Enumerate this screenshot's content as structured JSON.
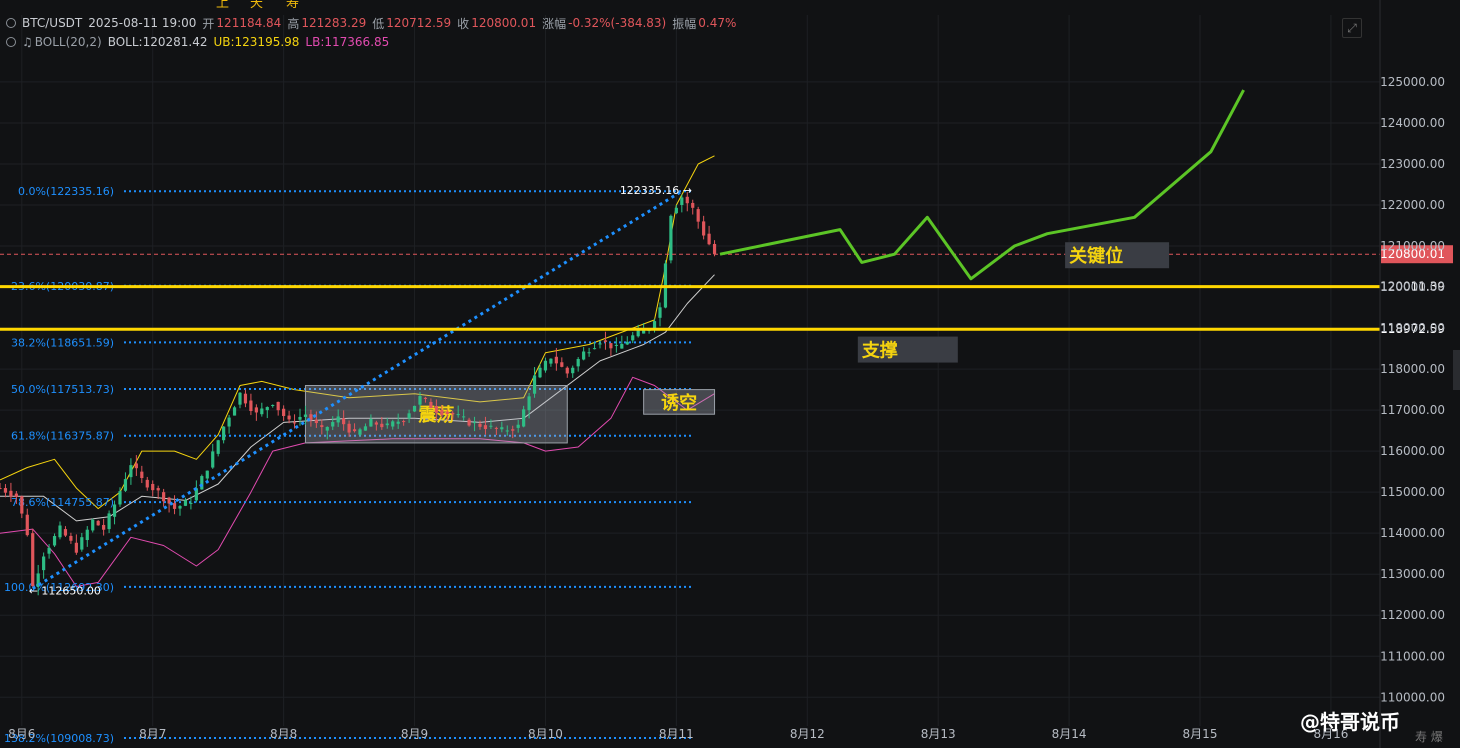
{
  "header": {
    "pair": "BTC/USDT",
    "datetime": "2025-08-11 19:00",
    "open_label": "开",
    "open": "121184.84",
    "high_label": "高",
    "high": "121283.29",
    "low_label": "低",
    "low": "120712.59",
    "close_label": "收",
    "close": "120800.01",
    "change_label": "涨幅",
    "change": "-0.32%(-384.83)",
    "amp_label": "振幅",
    "amp": "0.47%"
  },
  "indicator": {
    "name": "BOLL(20,2)",
    "boll": "BOLL:120281.42",
    "ub": "UB:123195.98",
    "lb": "LB:117366.85"
  },
  "toolbar": {
    "items": [
      "上",
      "天",
      "寿",
      "⟲",
      "≈",
      "⊡",
      "⊘",
      "⊟",
      "⊖",
      "⊕",
      "⊚",
      "⊏",
      "⊐"
    ]
  },
  "expand_icon": "expand-icon",
  "brand": "@特哥说币",
  "footer_note": "寿 爆",
  "colors": {
    "background": "#111214",
    "up": "#2ebd85",
    "down": "#e0565b",
    "fib": "#1e90ff",
    "boll_mid": "#cfcfcf",
    "boll_ub": "#f5d40f",
    "boll_lb": "#e24bb0",
    "key_line": "#ffd700",
    "forecast": "#5cc526"
  },
  "chart_data": {
    "type": "candlestick",
    "title": "",
    "ylim": [
      109300,
      125900
    ],
    "xlim": [
      "2025-08-05 20:00",
      "2025-08-16 09:00"
    ],
    "grid": true,
    "x_ticks": [
      "8月6",
      "8月7",
      "8月8",
      "8月9",
      "8月10",
      "8月11",
      "8月12",
      "8月13",
      "8月14",
      "8月15",
      "8月16"
    ],
    "y_ticks": [
      "110000.00",
      "111000.00",
      "112000.00",
      "113000.00",
      "114000.00",
      "115000.00",
      "116000.00",
      "117000.00",
      "118000.00",
      "119000.00",
      "120000.00",
      "121000.00",
      "122000.00",
      "123000.00",
      "124000.00",
      "125000.00"
    ],
    "ohlc_path": [
      [
        "2025-08-05 20:00",
        115100
      ],
      [
        "2025-08-05 23:00",
        114900
      ],
      [
        "2025-08-06 01:00",
        114000
      ],
      [
        "2025-08-06 02:00",
        112700
      ],
      [
        "2025-08-06 04:00",
        113500
      ],
      [
        "2025-08-06 07:00",
        114100
      ],
      [
        "2025-08-06 10:00",
        113600
      ],
      [
        "2025-08-06 13:00",
        114300
      ],
      [
        "2025-08-06 15:00",
        114100
      ],
      [
        "2025-08-06 17:00",
        114700
      ],
      [
        "2025-08-06 20:00",
        115700
      ],
      [
        "2025-08-06 22:00",
        115300
      ],
      [
        "2025-08-07 01:00",
        115000
      ],
      [
        "2025-08-07 04:00",
        114600
      ],
      [
        "2025-08-07 07:00",
        114800
      ],
      [
        "2025-08-07 10:00",
        115600
      ],
      [
        "2025-08-07 13:00",
        116600
      ],
      [
        "2025-08-07 16:00",
        117400
      ],
      [
        "2025-08-07 19:00",
        116900
      ],
      [
        "2025-08-07 22:00",
        117200
      ],
      [
        "2025-08-08 01:00",
        116700
      ],
      [
        "2025-08-08 04:00",
        116900
      ],
      [
        "2025-08-08 07:00",
        116500
      ],
      [
        "2025-08-08 10:00",
        116800
      ],
      [
        "2025-08-08 13:00",
        116400
      ],
      [
        "2025-08-08 16:00",
        116700
      ],
      [
        "2025-08-08 19:00",
        116600
      ],
      [
        "2025-08-08 22:00",
        116800
      ],
      [
        "2025-08-09 01:00",
        117300
      ],
      [
        "2025-08-09 04:00",
        117000
      ],
      [
        "2025-08-09 07:00",
        116900
      ],
      [
        "2025-08-09 10:00",
        116700
      ],
      [
        "2025-08-09 13:00",
        116600
      ],
      [
        "2025-08-09 16:00",
        116500
      ],
      [
        "2025-08-09 19:00",
        116600
      ],
      [
        "2025-08-09 22:00",
        117800
      ],
      [
        "2025-08-10 01:00",
        118300
      ],
      [
        "2025-08-10 04:00",
        117900
      ],
      [
        "2025-08-10 07:00",
        118400
      ],
      [
        "2025-08-10 10:00",
        118700
      ],
      [
        "2025-08-10 13:00",
        118500
      ],
      [
        "2025-08-10 16:00",
        118800
      ],
      [
        "2025-08-10 19:00",
        119000
      ],
      [
        "2025-08-10 21:00",
        119500
      ],
      [
        "2025-08-10 23:00",
        121800
      ],
      [
        "2025-08-11 01:00",
        122200
      ],
      [
        "2025-08-11 03:00",
        121900
      ],
      [
        "2025-08-11 05:00",
        121300
      ],
      [
        "2025-08-11 07:00",
        120800
      ]
    ],
    "boll_ub": [
      [
        "2025-08-05 20:00",
        115300
      ],
      [
        "2025-08-06 01:00",
        115600
      ],
      [
        "2025-08-06 06:00",
        115800
      ],
      [
        "2025-08-06 10:00",
        115100
      ],
      [
        "2025-08-06 14:00",
        114600
      ],
      [
        "2025-08-06 18:00",
        115000
      ],
      [
        "2025-08-06 22:00",
        116000
      ],
      [
        "2025-08-07 04:00",
        116000
      ],
      [
        "2025-08-07 08:00",
        115800
      ],
      [
        "2025-08-07 12:00",
        116400
      ],
      [
        "2025-08-07 16:00",
        117600
      ],
      [
        "2025-08-07 20:00",
        117700
      ],
      [
        "2025-08-08 02:00",
        117500
      ],
      [
        "2025-08-08 12:00",
        117300
      ],
      [
        "2025-08-09 00:00",
        117400
      ],
      [
        "2025-08-09 12:00",
        117200
      ],
      [
        "2025-08-09 20:00",
        117300
      ],
      [
        "2025-08-10 00:00",
        118400
      ],
      [
        "2025-08-10 08:00",
        118600
      ],
      [
        "2025-08-10 16:00",
        119000
      ],
      [
        "2025-08-10 20:00",
        119200
      ],
      [
        "2025-08-10 22:00",
        120500
      ],
      [
        "2025-08-11 00:00",
        122000
      ],
      [
        "2025-08-11 04:00",
        123000
      ],
      [
        "2025-08-11 07:00",
        123200
      ]
    ],
    "boll_mid": [
      [
        "2025-08-05 20:00",
        114900
      ],
      [
        "2025-08-06 04:00",
        114900
      ],
      [
        "2025-08-06 10:00",
        114300
      ],
      [
        "2025-08-06 16:00",
        114400
      ],
      [
        "2025-08-06 22:00",
        114900
      ],
      [
        "2025-08-07 06:00",
        114800
      ],
      [
        "2025-08-07 12:00",
        115200
      ],
      [
        "2025-08-07 18:00",
        116100
      ],
      [
        "2025-08-08 00:00",
        116700
      ],
      [
        "2025-08-08 12:00",
        116800
      ],
      [
        "2025-08-09 00:00",
        116800
      ],
      [
        "2025-08-09 12:00",
        116700
      ],
      [
        "2025-08-09 20:00",
        116800
      ],
      [
        "2025-08-10 02:00",
        117400
      ],
      [
        "2025-08-10 10:00",
        118200
      ],
      [
        "2025-08-10 18:00",
        118600
      ],
      [
        "2025-08-10 22:00",
        118900
      ],
      [
        "2025-08-11 02:00",
        119600
      ],
      [
        "2025-08-11 07:00",
        120300
      ]
    ],
    "boll_lb": [
      [
        "2025-08-05 20:00",
        114000
      ],
      [
        "2025-08-06 02:00",
        114100
      ],
      [
        "2025-08-06 06:00",
        113500
      ],
      [
        "2025-08-06 10:00",
        112700
      ],
      [
        "2025-08-06 14:00",
        112800
      ],
      [
        "2025-08-06 20:00",
        113900
      ],
      [
        "2025-08-07 02:00",
        113700
      ],
      [
        "2025-08-07 08:00",
        113200
      ],
      [
        "2025-08-07 12:00",
        113600
      ],
      [
        "2025-08-07 18:00",
        115000
      ],
      [
        "2025-08-07 22:00",
        116000
      ],
      [
        "2025-08-08 04:00",
        116200
      ],
      [
        "2025-08-08 20:00",
        116300
      ],
      [
        "2025-08-09 12:00",
        116300
      ],
      [
        "2025-08-09 20:00",
        116200
      ],
      [
        "2025-08-10 00:00",
        116000
      ],
      [
        "2025-08-10 06:00",
        116100
      ],
      [
        "2025-08-10 12:00",
        116800
      ],
      [
        "2025-08-10 16:00",
        117800
      ],
      [
        "2025-08-10 20:00",
        117600
      ],
      [
        "2025-08-11 02:00",
        117000
      ],
      [
        "2025-08-11 07:00",
        117400
      ]
    ],
    "fib_levels": [
      {
        "label": "0.0%(122335.16)",
        "value": 122335.16
      },
      {
        "label": "23.6%(120030.87)",
        "value": 120030.87
      },
      {
        "label": "38.2%(118651.59)",
        "value": 118651.59
      },
      {
        "label": "50.0%(117513.73)",
        "value": 117513.73
      },
      {
        "label": "61.8%(116375.87)",
        "value": 116375.87
      },
      {
        "label": "78.6%(114755.87)",
        "value": 114755.87
      },
      {
        "label": "100.0%(112692.30)",
        "value": 112692.3
      },
      {
        "label": "138.2%(109008.73)",
        "value": 109008.73
      }
    ],
    "fib_end": "2025-08-11 03:00",
    "trend_line": {
      "from": [
        "2025-08-06 02:00",
        112650
      ],
      "to": [
        "2025-08-11 01:00",
        122335.16
      ],
      "start_label": "← 112650.00",
      "end_label": "122335.16 →"
    },
    "key_lines": [
      {
        "value": 120011.39,
        "label": "120011.39"
      },
      {
        "value": 118972.59,
        "label": "118972.59"
      }
    ],
    "last_price": {
      "value": 120800.01,
      "label": "120800.01"
    },
    "zones": [
      {
        "label": "震荡",
        "from": "2025-08-08 04:00",
        "to": "2025-08-10 04:00",
        "top": 117600,
        "bottom": 116200
      },
      {
        "label": "诱空",
        "from": "2025-08-10 18:00",
        "to": "2025-08-11 07:00",
        "top": 117500,
        "bottom": 116900
      }
    ],
    "annotations": [
      {
        "text": "关键位",
        "x": "2025-08-14 00:00",
        "y": 120800
      },
      {
        "text": "支撑",
        "x": "2025-08-12 10:00",
        "y": 118500
      }
    ],
    "forecast": [
      [
        "2025-08-11 08:00",
        120800
      ],
      [
        "2025-08-12 06:00",
        121400
      ],
      [
        "2025-08-12 10:00",
        120600
      ],
      [
        "2025-08-12 16:00",
        120800
      ],
      [
        "2025-08-12 22:00",
        121700
      ],
      [
        "2025-08-13 06:00",
        120200
      ],
      [
        "2025-08-13 14:00",
        121000
      ],
      [
        "2025-08-13 20:00",
        121300
      ],
      [
        "2025-08-14 12:00",
        121700
      ],
      [
        "2025-08-15 02:00",
        123300
      ],
      [
        "2025-08-15 08:00",
        124800
      ]
    ]
  }
}
